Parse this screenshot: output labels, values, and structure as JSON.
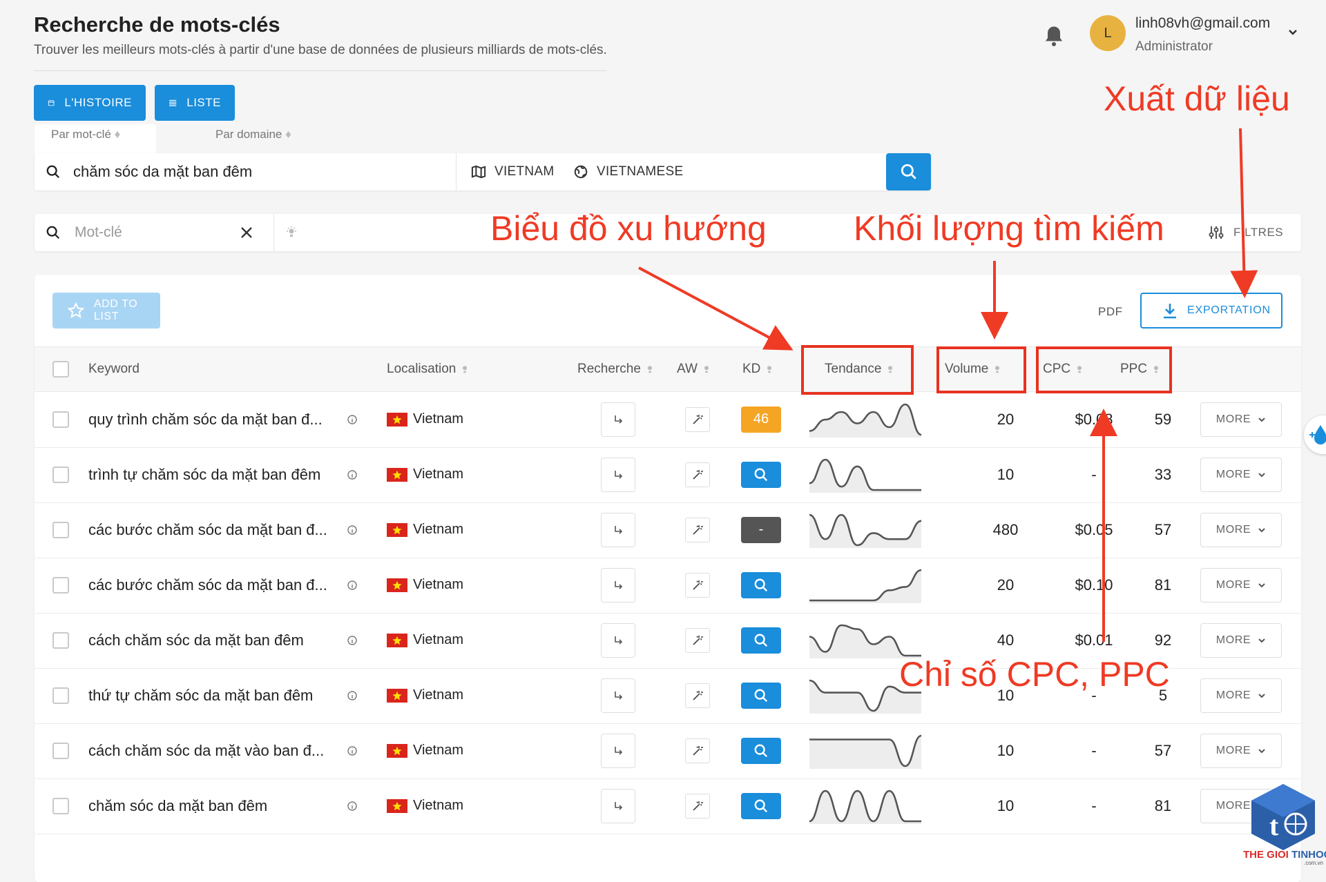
{
  "header": {
    "title": "Recherche de mots-clés",
    "subtitle": "Trouver les meilleurs mots-clés à partir d'une base de données de plusieurs milliards de mots-clés."
  },
  "top_buttons": {
    "history": "L'HISTOIRE",
    "list": "LISTE"
  },
  "user": {
    "avatar_initial": "L",
    "email": "linh08vh@gmail.com",
    "role": "Administrator"
  },
  "tabs": {
    "by_keyword": "Par mot-clé",
    "by_domain": "Par domaine"
  },
  "search": {
    "query": "chăm sóc da mặt ban đêm",
    "country": "VIETNAM",
    "language": "VIETNAMESE"
  },
  "filter": {
    "placeholder": "Mot-clé",
    "filters_label": "FILTRES"
  },
  "toolbar": {
    "add_to_list": "ADD TO LIST",
    "pdf": "PDF",
    "export": "EXPORTATION"
  },
  "columns": {
    "keyword": "Keyword",
    "location": "Localisation",
    "search": "Recherche",
    "aw": "AW",
    "kd": "KD",
    "trend": "Tendance",
    "volume": "Volume",
    "cpc": "CPC",
    "ppc": "PPC"
  },
  "more_label": "MORE",
  "colors": {
    "primary": "#1a8ddb",
    "kd_orange": "#f5a524",
    "kd_gray": "#555555",
    "annotation": "#ef3a24"
  },
  "rows": [
    {
      "keyword": "quy trình chăm sóc da mặt ban đ...",
      "location": "Vietnam",
      "kd": "46",
      "kd_type": "score",
      "volume": "20",
      "cpc": "$0.08",
      "ppc": "59",
      "trend": [
        3,
        6,
        8,
        5,
        8,
        4,
        10,
        2
      ]
    },
    {
      "keyword": "trình tự chăm sóc da mặt ban đêm",
      "location": "Vietnam",
      "kd": "",
      "kd_type": "search",
      "volume": "10",
      "cpc": "-",
      "ppc": "33",
      "trend": [
        3,
        10,
        2,
        8,
        1,
        1,
        1,
        1
      ]
    },
    {
      "keyword": "các bước chăm sóc da mặt ban đ...",
      "location": "Vietnam",
      "kd": "-",
      "kd_type": "none",
      "volume": "480",
      "cpc": "$0.05",
      "ppc": "57",
      "trend": [
        8,
        4,
        8,
        3,
        5,
        4,
        4,
        7
      ]
    },
    {
      "keyword": "các bước chăm sóc da mặt ban đ...",
      "location": "Vietnam",
      "kd": "",
      "kd_type": "search",
      "volume": "20",
      "cpc": "$0.10",
      "ppc": "81",
      "trend": [
        1,
        1,
        1,
        1,
        1,
        4,
        5,
        10
      ]
    },
    {
      "keyword": "cách chăm sóc da mặt ban đêm",
      "location": "Vietnam",
      "kd": "",
      "kd_type": "search",
      "volume": "40",
      "cpc": "$0.01",
      "ppc": "92",
      "trend": [
        6,
        2,
        9,
        8,
        4,
        6,
        1,
        1
      ]
    },
    {
      "keyword": "thứ tự chăm sóc da mặt ban đêm",
      "location": "Vietnam",
      "kd": "",
      "kd_type": "search",
      "volume": "10",
      "cpc": "-",
      "ppc": "5",
      "trend": [
        7,
        5,
        5,
        5,
        2,
        6,
        5,
        5
      ]
    },
    {
      "keyword": "cách chăm sóc da mặt vào ban đ...",
      "location": "Vietnam",
      "kd": "",
      "kd_type": "search",
      "volume": "10",
      "cpc": "-",
      "ppc": "57",
      "trend": [
        8,
        8,
        8,
        8,
        8,
        8,
        1,
        9
      ]
    },
    {
      "keyword": "chăm sóc da mặt ban đêm",
      "location": "Vietnam",
      "kd": "",
      "kd_type": "search",
      "volume": "10",
      "cpc": "-",
      "ppc": "81",
      "trend": [
        2,
        9,
        2,
        9,
        2,
        9,
        2,
        2
      ]
    }
  ],
  "annotations": {
    "trend": "Biểu đồ xu hướng",
    "volume": "Khối lượng tìm kiếm",
    "export": "Xuất dữ liệu",
    "cpc_ppc": "Chỉ số CPC, PPC"
  },
  "logo": {
    "text_left": "THE GIOI",
    "text_right": "TINHOC",
    "domain": ".com.vn"
  }
}
